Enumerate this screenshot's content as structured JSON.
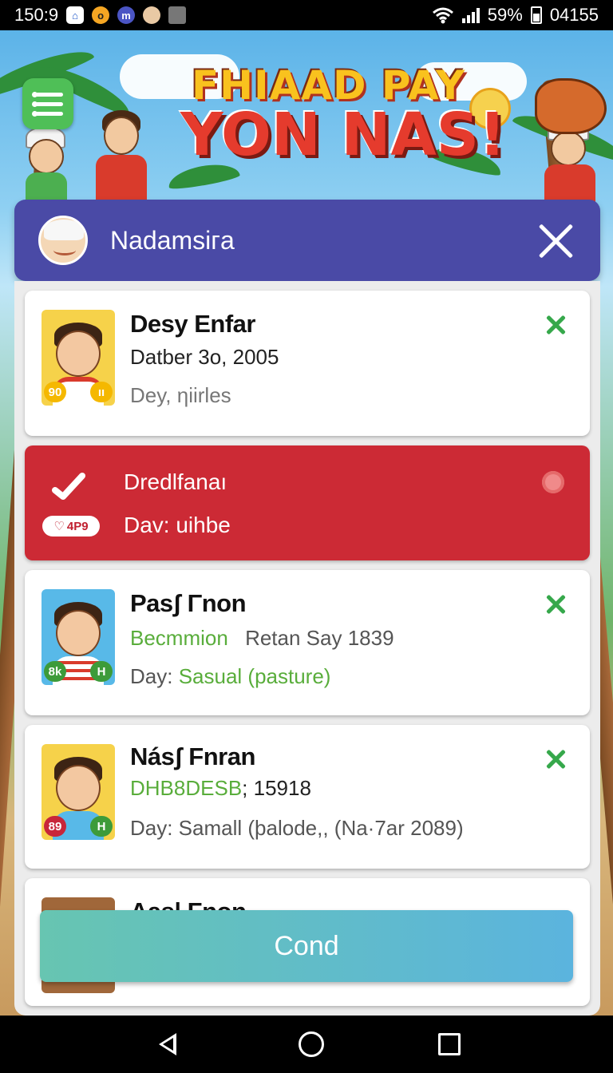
{
  "status_bar": {
    "time": "150:9",
    "battery": "59%",
    "clock_right": "04155",
    "icons": [
      "home-app-icon",
      "notification-o-icon",
      "notification-m-icon",
      "avatar-notification-icon",
      "bag-icon",
      "wifi-icon",
      "signal-icon",
      "battery-icon"
    ]
  },
  "banner": {
    "title_line1": "FHIAAD PAY",
    "title_line2": "YON NAS!"
  },
  "dialog": {
    "title": "Nadamsiгa",
    "close_icon": "close-icon"
  },
  "cards": [
    {
      "name": "Desy Enfar",
      "line1": "Datber 3o, 2005",
      "line2": "Dey, ηiirles",
      "badge_left": "90",
      "badge_right": "ıı"
    },
    {
      "title": "Dredlfanaı",
      "subtitle": "Dav:  uihbe",
      "pill": "4P9",
      "accent": "#cc2a35"
    },
    {
      "name": "Pasʃ Γnon",
      "line1_green": "Becmmion",
      "line1_rest": "Retan Saу 1839",
      "line2_label": "Day:",
      "line2_value": "Sasual (pasture)",
      "badge_left": "8k",
      "badge_right": "H"
    },
    {
      "name": "Násʃ Fnran",
      "line1_green": "DHB8DESB",
      "line1_rest": "; 15918",
      "line2": "Day: Samall  (þalоde,, (Na·7ar 2089)",
      "badge_left": "89",
      "badge_right": "H"
    },
    {
      "name": "Aas| Fnon"
    }
  ],
  "primary_button": {
    "label": "Cond"
  },
  "colors": {
    "header": "#4a4aa6",
    "alert_card": "#cc2a35",
    "check_green": "#36a84b",
    "button_gradient_start": "#67c5b1",
    "button_gradient_end": "#5bb4de"
  }
}
